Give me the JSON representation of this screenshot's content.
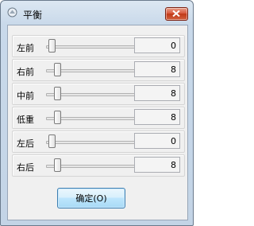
{
  "window": {
    "title": "平衡",
    "close_icon": "close-icon"
  },
  "sliders": [
    {
      "label": "左前",
      "value": "0",
      "level": 0
    },
    {
      "label": "右前",
      "value": "8",
      "level": 8
    },
    {
      "label": "中前",
      "value": "8",
      "level": 8
    },
    {
      "label": "低重",
      "value": "8",
      "level": 8
    },
    {
      "label": "左后",
      "value": "0",
      "level": 0
    },
    {
      "label": "右后",
      "value": "8",
      "level": 8
    }
  ],
  "buttons": {
    "ok": "确定(O)"
  },
  "colors": {
    "close_button": "#c8462b",
    "ok_border": "#3c7fb1",
    "panel_bg": "#f0f0f0"
  }
}
